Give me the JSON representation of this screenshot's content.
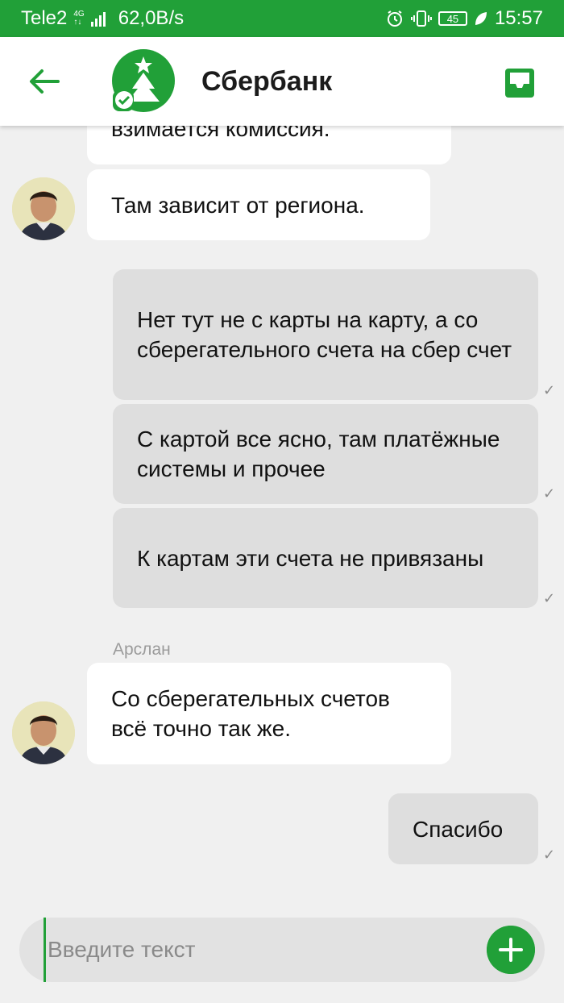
{
  "status_bar": {
    "carrier": "Tele2",
    "network": "4G",
    "speed": "62,0B/s",
    "battery": "45",
    "time": "15:57"
  },
  "header": {
    "title": "Сбербанк"
  },
  "messages": [
    {
      "direction": "in",
      "text": "взимается комиссия."
    },
    {
      "direction": "in",
      "text": "Там зависит от региона."
    },
    {
      "direction": "out",
      "text": "Нет тут не с карты на карту, а со сберегательного счета на сбер счет"
    },
    {
      "direction": "out",
      "text": "С картой все ясно, там платёжные системы и прочее"
    },
    {
      "direction": "out",
      "text": "К картам эти счета не привязаны"
    },
    {
      "direction": "in",
      "sender": "Арслан",
      "text": "Со сберегательных счетов всё точно так же."
    },
    {
      "direction": "out",
      "text": "Спасибо"
    }
  ],
  "input": {
    "placeholder": "Введите текст"
  },
  "colors": {
    "brand_green": "#21a038",
    "incoming_bubble": "#ffffff",
    "outgoing_bubble": "#dedede",
    "background": "#f0f0f0"
  },
  "icons": [
    "back-arrow-icon",
    "sberbank-logo",
    "inbox-icon",
    "read-check-icon",
    "plus-icon",
    "alarm-icon",
    "vibrate-icon",
    "leaf-icon",
    "signal-icon"
  ]
}
